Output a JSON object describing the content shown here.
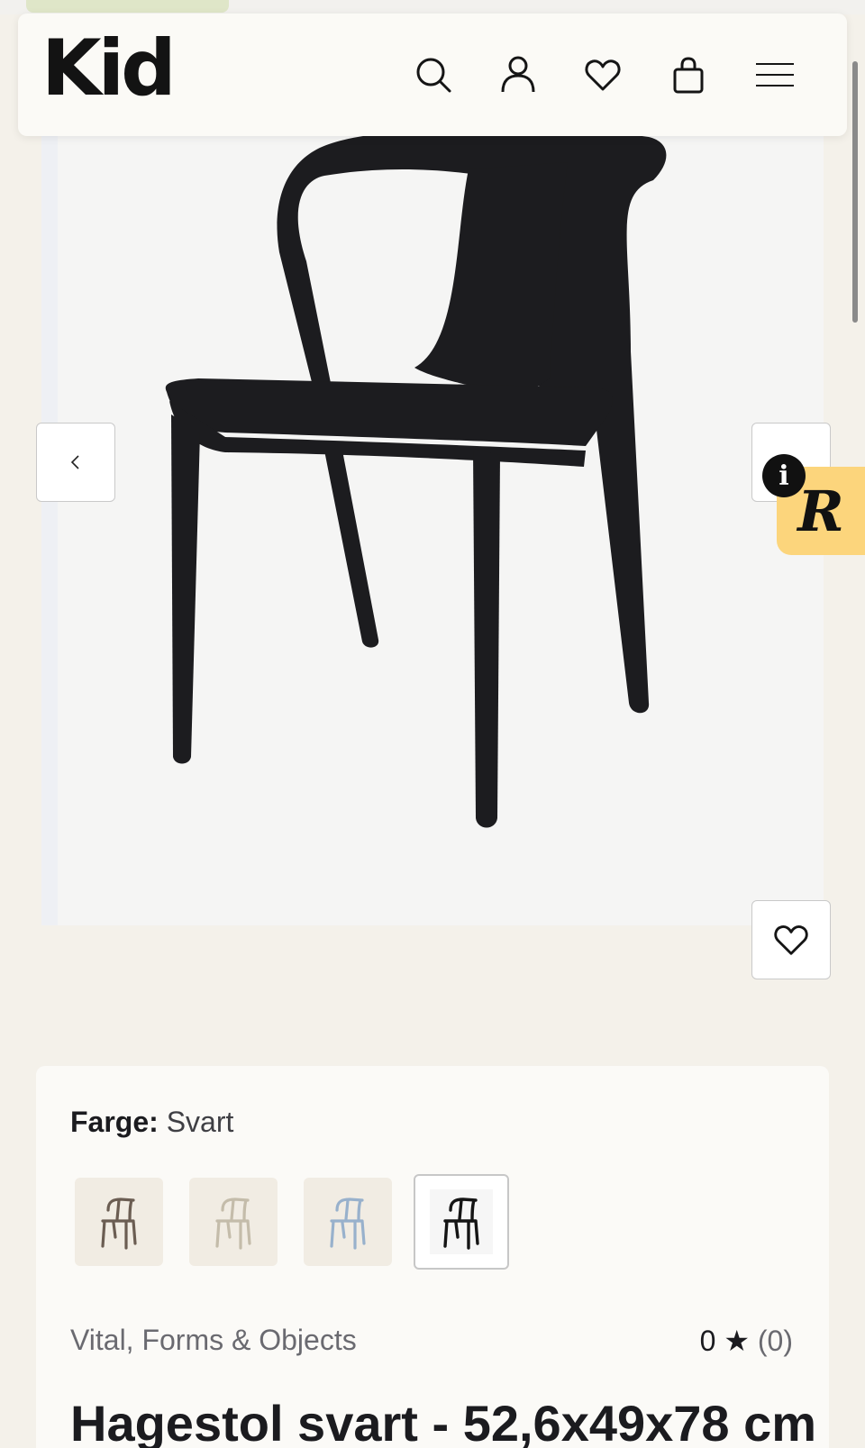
{
  "header": {
    "logo": "Kid",
    "icons": [
      "search-icon",
      "account-icon",
      "wishlist-icon",
      "cart-icon",
      "menu-icon"
    ]
  },
  "gallery": {
    "prev_icon": "chevron-left-icon",
    "next_icon": "chevron-right-icon",
    "favorite_icon": "heart-icon"
  },
  "widgets": {
    "info_label": "i",
    "reviews_logo": "R"
  },
  "product": {
    "color_label": "Farge:",
    "color_value": "Svart",
    "swatches": [
      {
        "name": "brown",
        "color": "#6b5d52"
      },
      {
        "name": "beige",
        "color": "#c4bcaa"
      },
      {
        "name": "blue",
        "color": "#98b1cc"
      },
      {
        "name": "black",
        "color": "#151515",
        "selected": true
      }
    ],
    "brand": "Vital, Forms & Objects",
    "rating_value": "0 ★",
    "rating_count": "(0)",
    "title": "Hagestol svart - 52,6x49x78 cm"
  },
  "colors": {
    "page_bg": "#f4f1ea",
    "header_bg": "#fbfaf6",
    "accent_yellow": "#fcd57c",
    "promo_green": "#dfe6c8"
  }
}
